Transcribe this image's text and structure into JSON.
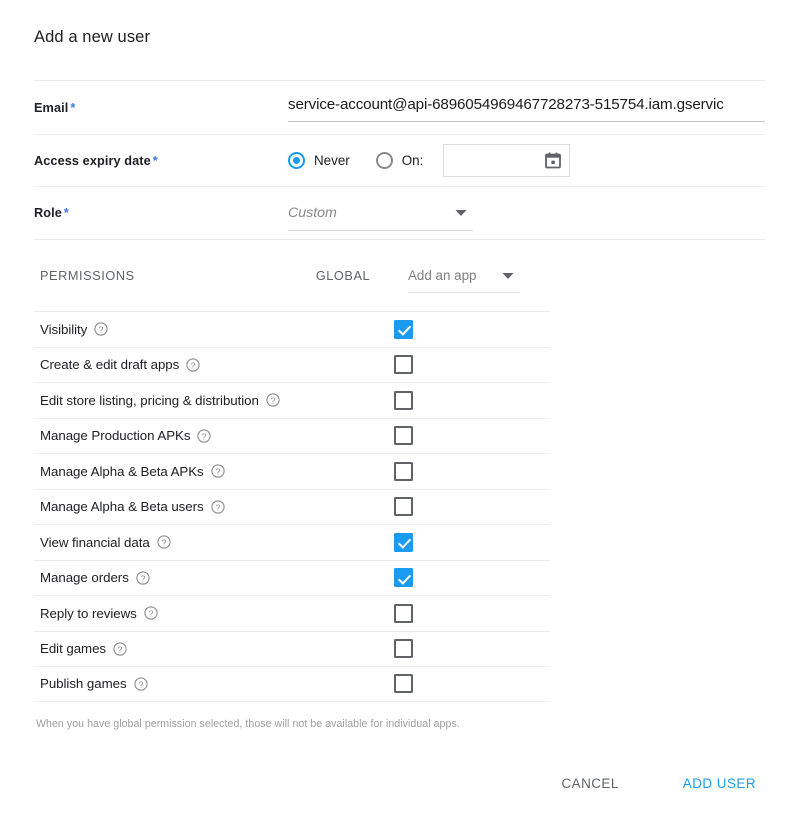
{
  "dialog": {
    "title": "Add a new user"
  },
  "form": {
    "email": {
      "label": "Email",
      "required_marker": "*",
      "value": "service-account@api-6896054969467728273-515754.iam.gservic"
    },
    "expiry": {
      "label": "Access expiry date",
      "required_marker": "*",
      "options": [
        {
          "label": "Never",
          "selected": true
        },
        {
          "label": "On:",
          "selected": false
        }
      ],
      "date_value": "",
      "calendar_icon": "calendar-icon"
    },
    "role": {
      "label": "Role",
      "required_marker": "*",
      "value": "Custom",
      "caret_icon": "chevron-down-icon"
    }
  },
  "permissions": {
    "section_label": "PERMISSIONS",
    "global_column_label": "GLOBAL",
    "add_app": {
      "label": "Add an app",
      "caret_icon": "chevron-down-icon"
    },
    "help_icon": "help-circle-icon",
    "rows": [
      {
        "name": "Visibility",
        "checked": true
      },
      {
        "name": "Create & edit draft apps",
        "checked": false
      },
      {
        "name": "Edit store listing, pricing & distribution",
        "checked": false
      },
      {
        "name": "Manage Production APKs",
        "checked": false
      },
      {
        "name": "Manage Alpha & Beta APKs",
        "checked": false
      },
      {
        "name": "Manage Alpha & Beta users",
        "checked": false
      },
      {
        "name": "View financial data",
        "checked": true
      },
      {
        "name": "Manage orders",
        "checked": true
      },
      {
        "name": "Reply to reviews",
        "checked": false
      },
      {
        "name": "Edit games",
        "checked": false
      },
      {
        "name": "Publish games",
        "checked": false
      }
    ],
    "note": "When you have global permission selected, those will not be available for individual apps."
  },
  "footer": {
    "cancel_label": "CANCEL",
    "submit_label": "ADD USER"
  },
  "colors": {
    "accent": "#1a9bf0",
    "required_star": "#3b78e7",
    "label_text": "#202124",
    "muted_text": "#5f6368",
    "divider": "#ececec"
  }
}
